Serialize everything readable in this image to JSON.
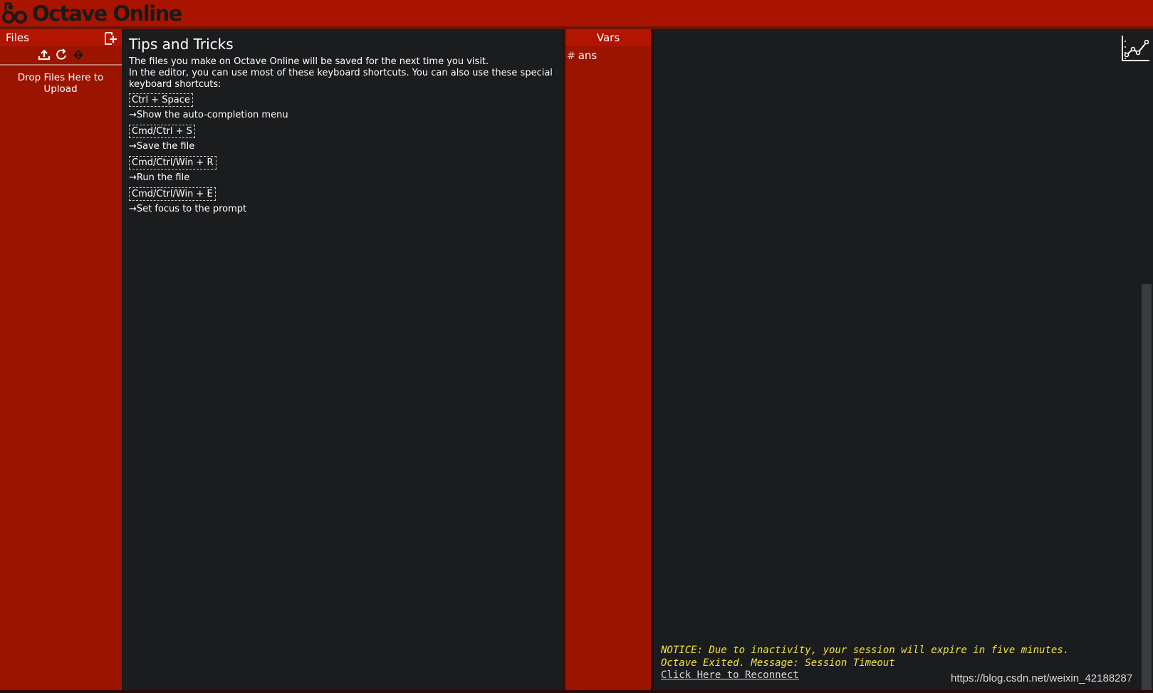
{
  "header": {
    "app_title": "Octave Online",
    "logo_icon": "octave-online-logo-icon"
  },
  "files": {
    "title": "Files",
    "new_file_icon": "new-file-icon",
    "tools": [
      "upload-icon",
      "refresh-icon",
      "git-icon"
    ],
    "drop_text": "Drop Files Here to Upload"
  },
  "editor": {
    "title": "Tips and Tricks",
    "intro1": "The files you make on Octave Online will be saved for the next time you visit.",
    "intro2": "In the editor, you can use most of these keyboard shortcuts. You can also use these special keyboard shortcuts:",
    "shortcuts": [
      {
        "keys": "Ctrl + Space",
        "desc": "→Show the auto-completion menu"
      },
      {
        "keys": "Cmd/Ctrl + S",
        "desc": "→Save the file"
      },
      {
        "keys": "Cmd/Ctrl/Win + R",
        "desc": "→Run the file"
      },
      {
        "keys": "Cmd/Ctrl/Win + E",
        "desc": "→Set focus to the prompt"
      }
    ]
  },
  "vars": {
    "title": "Vars",
    "items": [
      {
        "type_symbol": "#",
        "name": "ans"
      }
    ]
  },
  "console": {
    "plot_icon": "plot-icon",
    "notice_line1": "NOTICE: Due to inactivity, your session will expire in five minutes.",
    "notice_line2": "Octave Exited. Message: Session Timeout",
    "reconnect": "Click Here to Reconnect"
  },
  "watermark": "https://blog.csdn.net/weixin_42188287",
  "colors": {
    "brand_red": "#a81400",
    "panel_red": "#9b1400",
    "notice_yellow": "#f5e340",
    "bg": "#1b1c1e"
  }
}
